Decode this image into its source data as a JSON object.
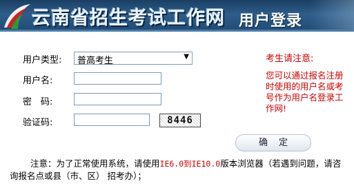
{
  "header": {
    "site_title": "云南省招生考试工作网",
    "login_title": "用户登录",
    "brand_color": "#2f5d8a"
  },
  "form": {
    "user_type_label": "用户类型:",
    "user_type_value": "普高考生",
    "username_label": "用户名:",
    "username_value": "",
    "password_label": "密　码:",
    "password_value": "",
    "captcha_label": "验证码:",
    "captcha_value": "",
    "captcha_image_text": "8446",
    "confirm_label": "确定"
  },
  "notice": {
    "title": "考生请注意:",
    "body": "您可以通过报名注册时使用的用户名或考号作为用户名登录工作网!",
    "color": "#cc0000"
  },
  "footer": {
    "note_prefix": "注意：为了正常使用系统，请使用",
    "browser_versions": "IE6.0到IE10.0",
    "note_suffix": "版本浏览器（若遇到问题，请咨询报名点或县（市、区） 招考办）；"
  }
}
